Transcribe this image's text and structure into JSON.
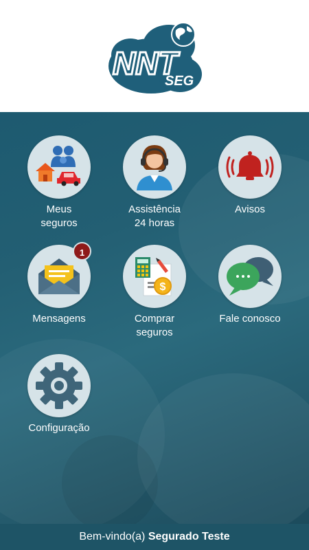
{
  "brand": {
    "logo_text_main": "NNT",
    "logo_text_sub": "SEG"
  },
  "colors": {
    "teal": "#1d5a70",
    "circle_bg": "#d6e3e8",
    "badge": "#8e1a1a",
    "footer": "#1e5466"
  },
  "menu": [
    {
      "id": "meus-seguros",
      "label": "Meus\nseguros",
      "icon": "family-house-car-icon"
    },
    {
      "id": "assistencia",
      "label": "Assistência\n24 horas",
      "icon": "headset-agent-icon"
    },
    {
      "id": "avisos",
      "label": "Avisos",
      "icon": "bell-icon"
    },
    {
      "id": "mensagens",
      "label": "Mensagens",
      "icon": "envelope-icon",
      "badge": "1"
    },
    {
      "id": "comprar",
      "label": "Comprar\nseguros",
      "icon": "calculator-coin-icon"
    },
    {
      "id": "fale",
      "label": "Fale conosco",
      "icon": "chat-bubbles-icon"
    },
    {
      "id": "config",
      "label": "Configuração",
      "icon": "gear-icon"
    }
  ],
  "footer": {
    "welcome": "Bem-vindo(a)",
    "user_name": "Segurado Teste"
  }
}
